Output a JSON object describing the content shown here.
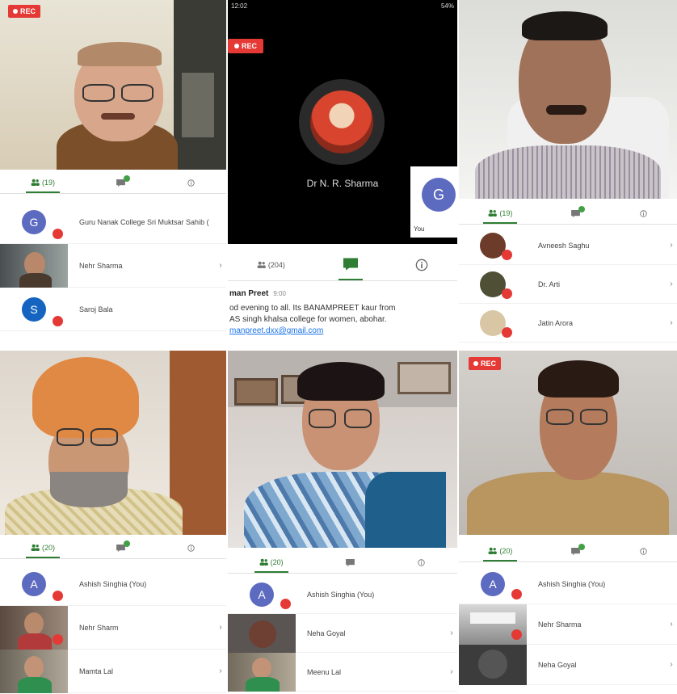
{
  "colors": {
    "accent": "#2e7d32",
    "record": "#e53935",
    "avatar_purple": "#5c6bc0",
    "avatar_blue": "#1565c0",
    "chat_link": "#1a73e8"
  },
  "rec_label": "REC",
  "panel1": {
    "tabs": {
      "people_count": "(19)"
    },
    "participants": [
      {
        "initial": "G",
        "name": "Guru Nanak College Sri Muktsar Sahib ("
      },
      {
        "initial": "",
        "name": "Nehr Sharma"
      },
      {
        "initial": "S",
        "name": "Saroj Bala"
      }
    ]
  },
  "panel2": {
    "status_bar": {
      "time": "12:02",
      "battery": "54%"
    },
    "presenter_name": "Dr N. R. Sharma",
    "tile_initial": "G",
    "tile_label": "You",
    "people_label": "(204)",
    "chat": {
      "author": "man Preet",
      "time": "9:00",
      "message_line1": "od evening to all. Its BANAMPREET kaur from",
      "message_line2": "AS singh khalsa college for women, abohar.",
      "email": "manpreet.dxx@gmail.com"
    }
  },
  "panel3": {
    "tabs": {
      "people_count": "(19)"
    },
    "participants": [
      {
        "initial": "",
        "name": "Avneesh Saghu"
      },
      {
        "initial": "",
        "name": "Dr. Arti"
      },
      {
        "initial": "",
        "name": "Jatin Arora"
      }
    ]
  },
  "panel4": {
    "tabs": {
      "people_count": "(20)"
    },
    "participants": [
      {
        "initial": "A",
        "name": "Ashish Singhia (You)"
      },
      {
        "initial": "",
        "name": "Nehr Sharm"
      },
      {
        "initial": "",
        "name": "Mamta Lal"
      }
    ]
  },
  "panel5": {
    "tabs": {
      "people_count": "(20)"
    },
    "participants": [
      {
        "initial": "A",
        "name": "Ashish Singhia (You)"
      },
      {
        "initial": "",
        "name": "Neha Goyal"
      },
      {
        "initial": "",
        "name": "Meenu Lal"
      }
    ]
  },
  "panel6": {
    "tabs": {
      "people_count": "(20)"
    },
    "participants": [
      {
        "initial": "A",
        "name": "Ashish Singhia (You)"
      },
      {
        "initial": "",
        "name": "Nehr Sharma"
      },
      {
        "initial": "",
        "name": "Neha Goyal"
      }
    ]
  }
}
